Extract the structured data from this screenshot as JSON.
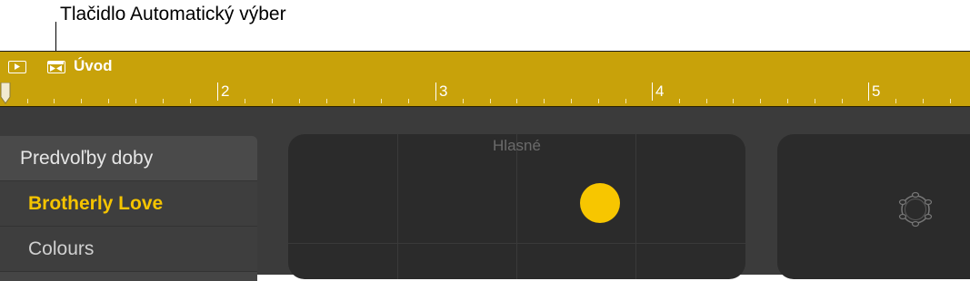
{
  "callout": {
    "label": "Tlačidlo Automatický výber"
  },
  "ruler": {
    "section_name": "Úvod",
    "bar_numbers": [
      "2",
      "3",
      "4",
      "5"
    ],
    "controls": [
      {
        "name": "play-button",
        "icon": "play-icon"
      },
      {
        "name": "auto-select-button",
        "icon": "auto-select-icon"
      }
    ],
    "colors": {
      "background": "#c8a20a",
      "text": "#ffffff"
    }
  },
  "presets": {
    "header": "Predvoľby doby",
    "items": [
      {
        "label": "Brotherly Love",
        "selected": true
      },
      {
        "label": "Colours",
        "selected": false
      }
    ],
    "colors": {
      "selected": "#f5c400"
    }
  },
  "xy_pad": {
    "label": "Hlasné"
  },
  "drum_pad": {
    "icon": "tambourine-icon"
  },
  "theme": {
    "accent": "#f7c600",
    "app_background": "#3b3b3b"
  }
}
